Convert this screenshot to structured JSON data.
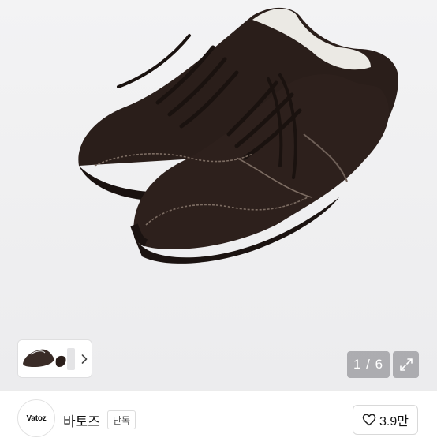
{
  "gallery": {
    "counter": "1 / 6",
    "current_index": 1,
    "total_images": 6,
    "thumbnail_icon": "shoe-thumbnail",
    "next_icon": "chevron-right-icon",
    "expand_icon": "expand-icon"
  },
  "store": {
    "logo_text": "Vatoz",
    "name": "바토즈",
    "badge": "단독"
  },
  "like": {
    "icon": "heart-icon",
    "count": "3.9만"
  },
  "colors": {
    "background": "#efeff0",
    "shoe": "#2b1f1b",
    "stitch": "#8a7a70",
    "overlay": "#7c7c80"
  }
}
